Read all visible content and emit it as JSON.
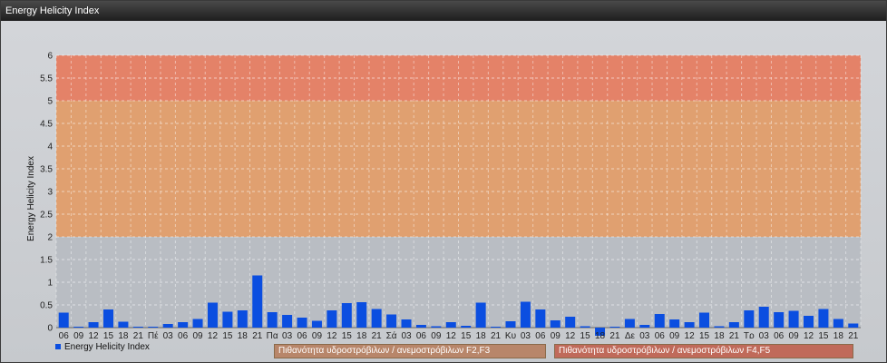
{
  "window": {
    "title": "Energy Helicity Index"
  },
  "colors": {
    "bar": "#0b4ee0",
    "zone_f2f3": "#e0a070",
    "zone_f4f5": "#e48268",
    "zone_low": "#b9bdc3",
    "legend_f2f3": "#b8866a",
    "legend_f4f5": "#c06a5a"
  },
  "legend": {
    "series_label": "Energy Helicity Index",
    "zone_f2f3_label": "Πιθανότητα υδροστρόβιλων / ανεμοστρόβιλων F2,F3",
    "zone_f4f5_label": "Πιθανότητα υδροστρόβιλων / ανεμοστρόβιλων F4,F5"
  },
  "chart_data": {
    "type": "bar",
    "ylabel": "Energy Helicity Index",
    "ylim": [
      0,
      6
    ],
    "yticks": [
      "0",
      "0.5",
      "1",
      "1.5",
      "2",
      "2.5",
      "3",
      "3.5",
      "4",
      "4.5",
      "5",
      "5.5",
      "6"
    ],
    "grid": true,
    "legend_position": "bottom-left",
    "zones": [
      {
        "from": 2,
        "to": 5,
        "name": "Πιθανότητα υδροστρόβιλων / ανεμοστρόβιλων F2,F3"
      },
      {
        "from": 5,
        "to": 6,
        "name": "Πιθανότητα υδροστρόβιλων / ανεμοστρόβιλων F4,F5"
      }
    ],
    "categories": [
      "06",
      "09",
      "12",
      "15",
      "18",
      "21",
      "Πέ",
      "03",
      "06",
      "09",
      "12",
      "15",
      "18",
      "21",
      "Πα",
      "03",
      "06",
      "09",
      "12",
      "15",
      "18",
      "21",
      "Σά",
      "03",
      "06",
      "09",
      "12",
      "15",
      "18",
      "21",
      "Κυ",
      "03",
      "06",
      "09",
      "12",
      "15",
      "18",
      "21",
      "Δε",
      "03",
      "06",
      "09",
      "12",
      "15",
      "18",
      "21",
      "Τρ",
      "03",
      "06",
      "09",
      "12",
      "15",
      "18",
      "21"
    ],
    "series": [
      {
        "name": "Energy Helicity Index",
        "values": [
          0.33,
          0.02,
          0.12,
          0.4,
          0.13,
          0.02,
          0.02,
          0.08,
          0.12,
          0.19,
          0.55,
          0.35,
          0.38,
          1.15,
          0.34,
          0.28,
          0.22,
          0.15,
          0.38,
          0.54,
          0.56,
          0.41,
          0.29,
          0.18,
          0.06,
          0.03,
          0.12,
          0.04,
          0.55,
          0.02,
          0.14,
          0.57,
          0.4,
          0.16,
          0.24,
          0.03,
          -0.18,
          0.02,
          0.19,
          0.06,
          0.3,
          0.18,
          0.12,
          0.33,
          0.03,
          0.12,
          0.38,
          0.46,
          0.34,
          0.37,
          0.26,
          0.41,
          0.19,
          0.09
        ]
      }
    ]
  }
}
